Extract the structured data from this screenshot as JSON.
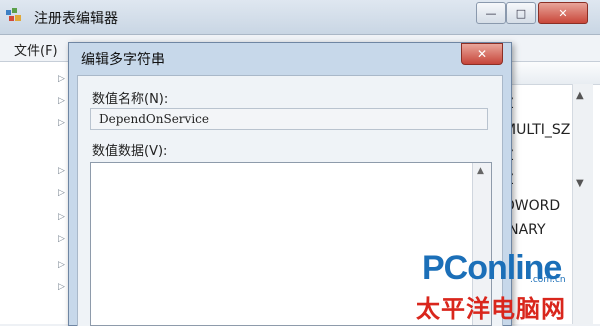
{
  "window": {
    "title": "注册表编辑器",
    "controls": {
      "minimize": "—",
      "maximize": "□",
      "close": "✕"
    }
  },
  "menu": {
    "file_label": "文件(F)"
  },
  "tree": {
    "expand_marker": "▷"
  },
  "right_pane": {
    "type_items": [
      "Z",
      "MULTI_SZ",
      "Z",
      "Z",
      "DWORD",
      "INARY"
    ],
    "scroll_up": "▲",
    "scroll_down": "▼"
  },
  "dialog": {
    "title": "编辑多字符串",
    "close": "✕",
    "value_name_label": "数值名称(N):",
    "value_name": "DependOnService",
    "value_data_label": "数值数据(V):",
    "value_data": "",
    "scroll_up": "▲"
  },
  "watermark": {
    "brand": "PConline",
    "domain": ".com.cn",
    "chinese": "太平洋电脑网"
  },
  "colors": {
    "accent": "#1b6fb8",
    "watermark_red": "#d9261c",
    "close_red": "#c6453a"
  }
}
